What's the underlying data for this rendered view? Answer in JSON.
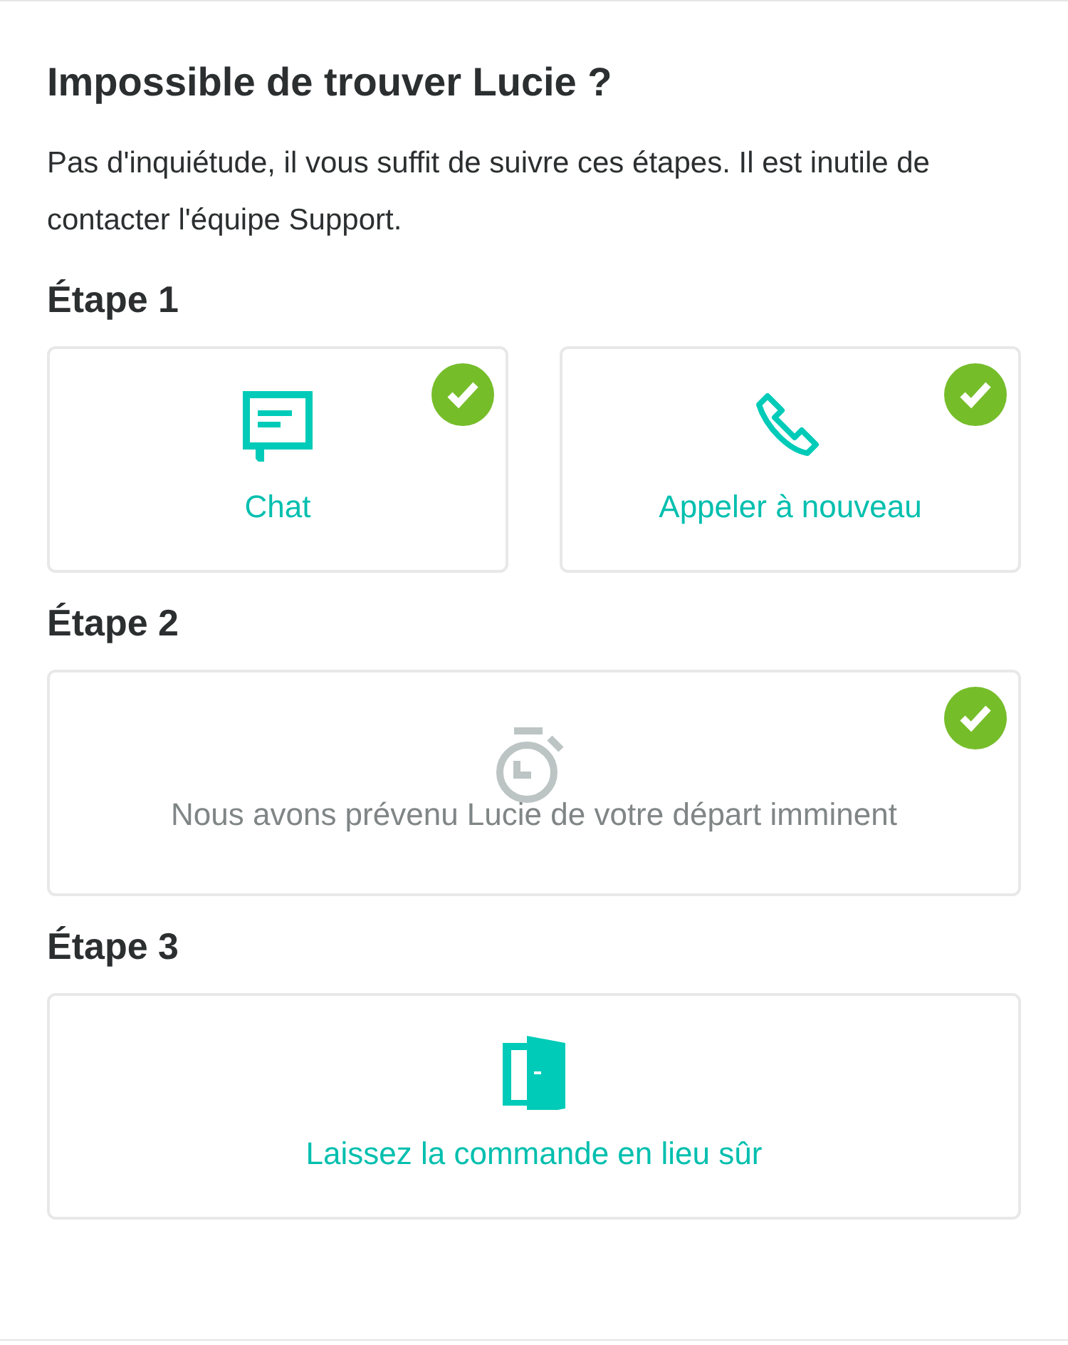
{
  "title": "Impossible de trouver Lucie ?",
  "intro": "Pas d'inquiétude, il vous suffit de suivre ces étapes. Il est inutile de contacter l'équipe Support.",
  "steps": [
    {
      "heading": "Étape 1",
      "options": [
        {
          "kind": "chat",
          "label": "Chat",
          "checked": true,
          "disabled": false
        },
        {
          "kind": "phone",
          "label": "Appeler à nouveau",
          "checked": true,
          "disabled": false
        }
      ]
    },
    {
      "heading": "Étape 2",
      "options": [
        {
          "kind": "timer",
          "label": "Nous avons prévenu Lucie de votre départ imminent",
          "checked": true,
          "disabled": true
        }
      ]
    },
    {
      "heading": "Étape 3",
      "options": [
        {
          "kind": "door",
          "label": "Laissez la commande en lieu sûr",
          "checked": false,
          "disabled": false
        }
      ]
    }
  ]
}
